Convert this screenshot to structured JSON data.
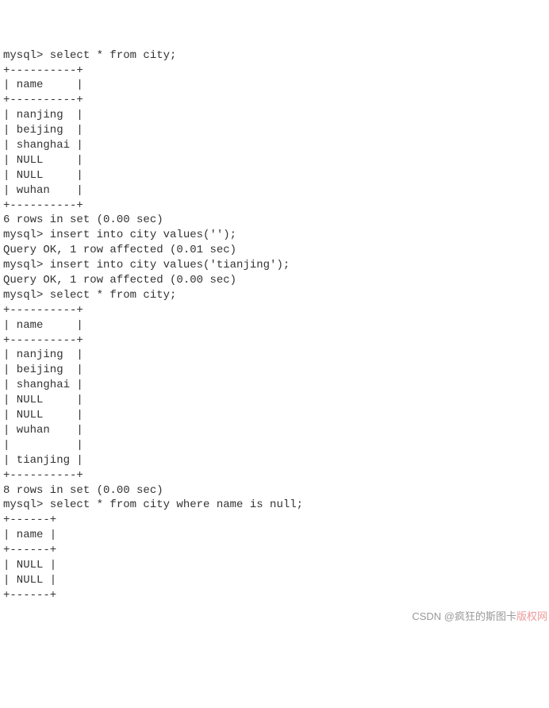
{
  "terminal": {
    "lines": [
      "mysql> select * from city;",
      "+----------+",
      "| name     |",
      "+----------+",
      "| nanjing  |",
      "| beijing  |",
      "| shanghai |",
      "| NULL     |",
      "| NULL     |",
      "| wuhan    |",
      "+----------+",
      "6 rows in set (0.00 sec)",
      "",
      "mysql> insert into city values('');",
      "Query OK, 1 row affected (0.01 sec)",
      "",
      "mysql> insert into city values('tianjing');",
      "Query OK, 1 row affected (0.00 sec)",
      "",
      "mysql> select * from city;",
      "+----------+",
      "| name     |",
      "+----------+",
      "| nanjing  |",
      "| beijing  |",
      "| shanghai |",
      "| NULL     |",
      "| NULL     |",
      "| wuhan    |",
      "|          |",
      "| tianjing |",
      "+----------+",
      "8 rows in set (0.00 sec)",
      "",
      "mysql> select * from city where name is null;",
      "+------+",
      "| name |",
      "+------+",
      "| NULL |",
      "| NULL |",
      "+------+"
    ]
  },
  "queries": [
    {
      "sql": "select * from city;",
      "result_columns": [
        "name"
      ],
      "result_rows": [
        [
          "nanjing"
        ],
        [
          "beijing"
        ],
        [
          "shanghai"
        ],
        [
          "NULL"
        ],
        [
          "NULL"
        ],
        [
          "wuhan"
        ]
      ],
      "summary": "6 rows in set (0.00 sec)"
    },
    {
      "sql": "insert into city values('');",
      "summary": "Query OK, 1 row affected (0.01 sec)"
    },
    {
      "sql": "insert into city values('tianjing');",
      "summary": "Query OK, 1 row affected (0.00 sec)"
    },
    {
      "sql": "select * from city;",
      "result_columns": [
        "name"
      ],
      "result_rows": [
        [
          "nanjing"
        ],
        [
          "beijing"
        ],
        [
          "shanghai"
        ],
        [
          "NULL"
        ],
        [
          "NULL"
        ],
        [
          "wuhan"
        ],
        [
          ""
        ],
        [
          "tianjing"
        ]
      ],
      "summary": "8 rows in set (0.00 sec)"
    },
    {
      "sql": "select * from city where name is null;",
      "result_columns": [
        "name"
      ],
      "result_rows": [
        [
          "NULL"
        ],
        [
          "NULL"
        ]
      ]
    }
  ],
  "watermark": {
    "left": "CSDN @疯狂的斯图卡",
    "right": "版权网"
  }
}
